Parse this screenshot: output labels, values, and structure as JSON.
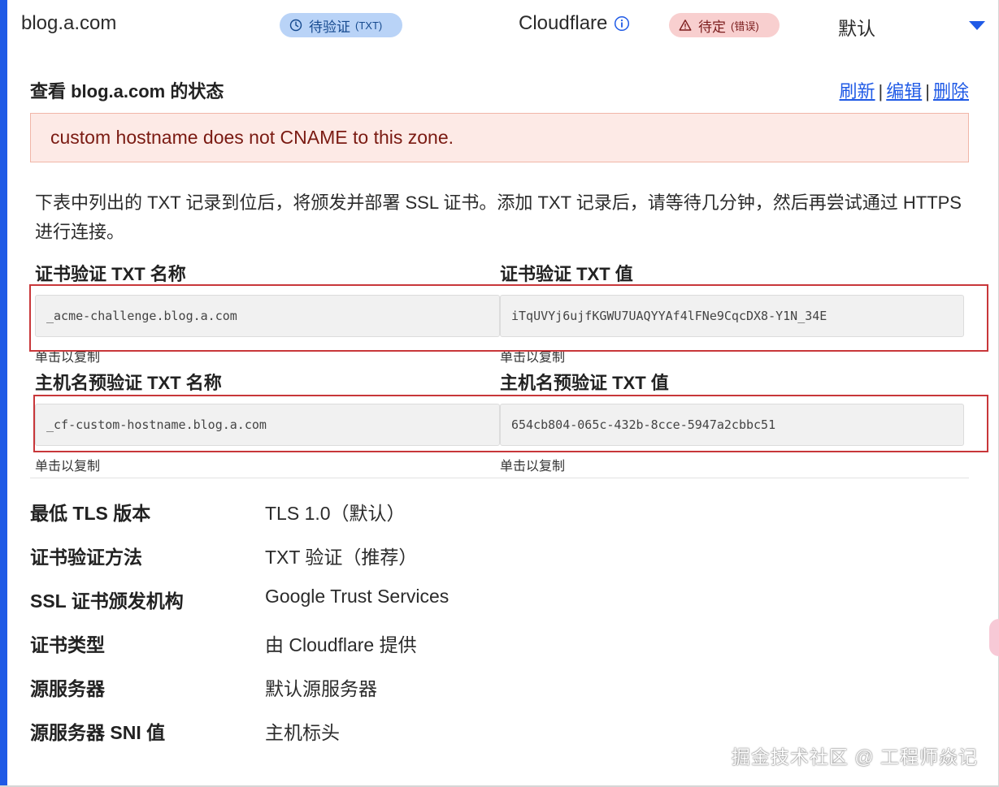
{
  "header": {
    "hostname": "blog.a.com",
    "cert_status": "待验证",
    "cert_status_sub": "(TXT)",
    "provider": "Cloudflare",
    "host_status": "待定",
    "host_status_sub": "(错误)",
    "origin": "默认",
    "icons": {
      "cert": "clock-icon",
      "provider": "info-icon",
      "host": "warning-icon",
      "expand": "caret-down-icon"
    },
    "colors": {
      "accent": "#1f5ae6",
      "cert_badge": "#b9d3f7",
      "host_badge": "#f8cfcf",
      "error_bg": "#fdeae6",
      "highlight": "#c8373a"
    }
  },
  "status": {
    "title": "查看 blog.a.com 的状态",
    "actions": {
      "refresh": "刷新",
      "edit": "编辑",
      "delete": "删除",
      "separator": "|"
    },
    "error": "custom hostname does not CNAME to this zone."
  },
  "description": "下表中列出的 TXT 记录到位后，将颁发并部署 SSL 证书。添加 TXT 记录后，请等待几分钟，然后再尝试通过 HTTPS 进行连接。",
  "cert_txt": {
    "name_label": "证书验证 TXT 名称",
    "name_value": "_acme-challenge.blog.a.com",
    "value_label": "证书验证 TXT 值",
    "value_value": "iTqUVYj6ujfKGWU7UAQYYAf4lFNe9CqcDX8-Y1N_34E",
    "copy_hint": "单击以复制"
  },
  "host_txt": {
    "name_label": "主机名预验证 TXT 名称",
    "name_value": "_cf-custom-hostname.blog.a.com",
    "value_label": "主机名预验证 TXT 值",
    "value_value": "654cb804-065c-432b-8cce-5947a2cbbc51",
    "copy_hint": "单击以复制"
  },
  "details": [
    {
      "label": "最低 TLS 版本",
      "value": "TLS 1.0（默认）"
    },
    {
      "label": "证书验证方法",
      "value": "TXT 验证（推荐）"
    },
    {
      "label": "SSL 证书颁发机构",
      "value": "Google Trust Services"
    },
    {
      "label": "证书类型",
      "value": "由 Cloudflare 提供"
    },
    {
      "label": "源服务器",
      "value": "默认源服务器"
    },
    {
      "label": "源服务器 SNI 值",
      "value": "主机标头"
    }
  ],
  "watermark": "掘金技术社区 @ 工程师焱记"
}
